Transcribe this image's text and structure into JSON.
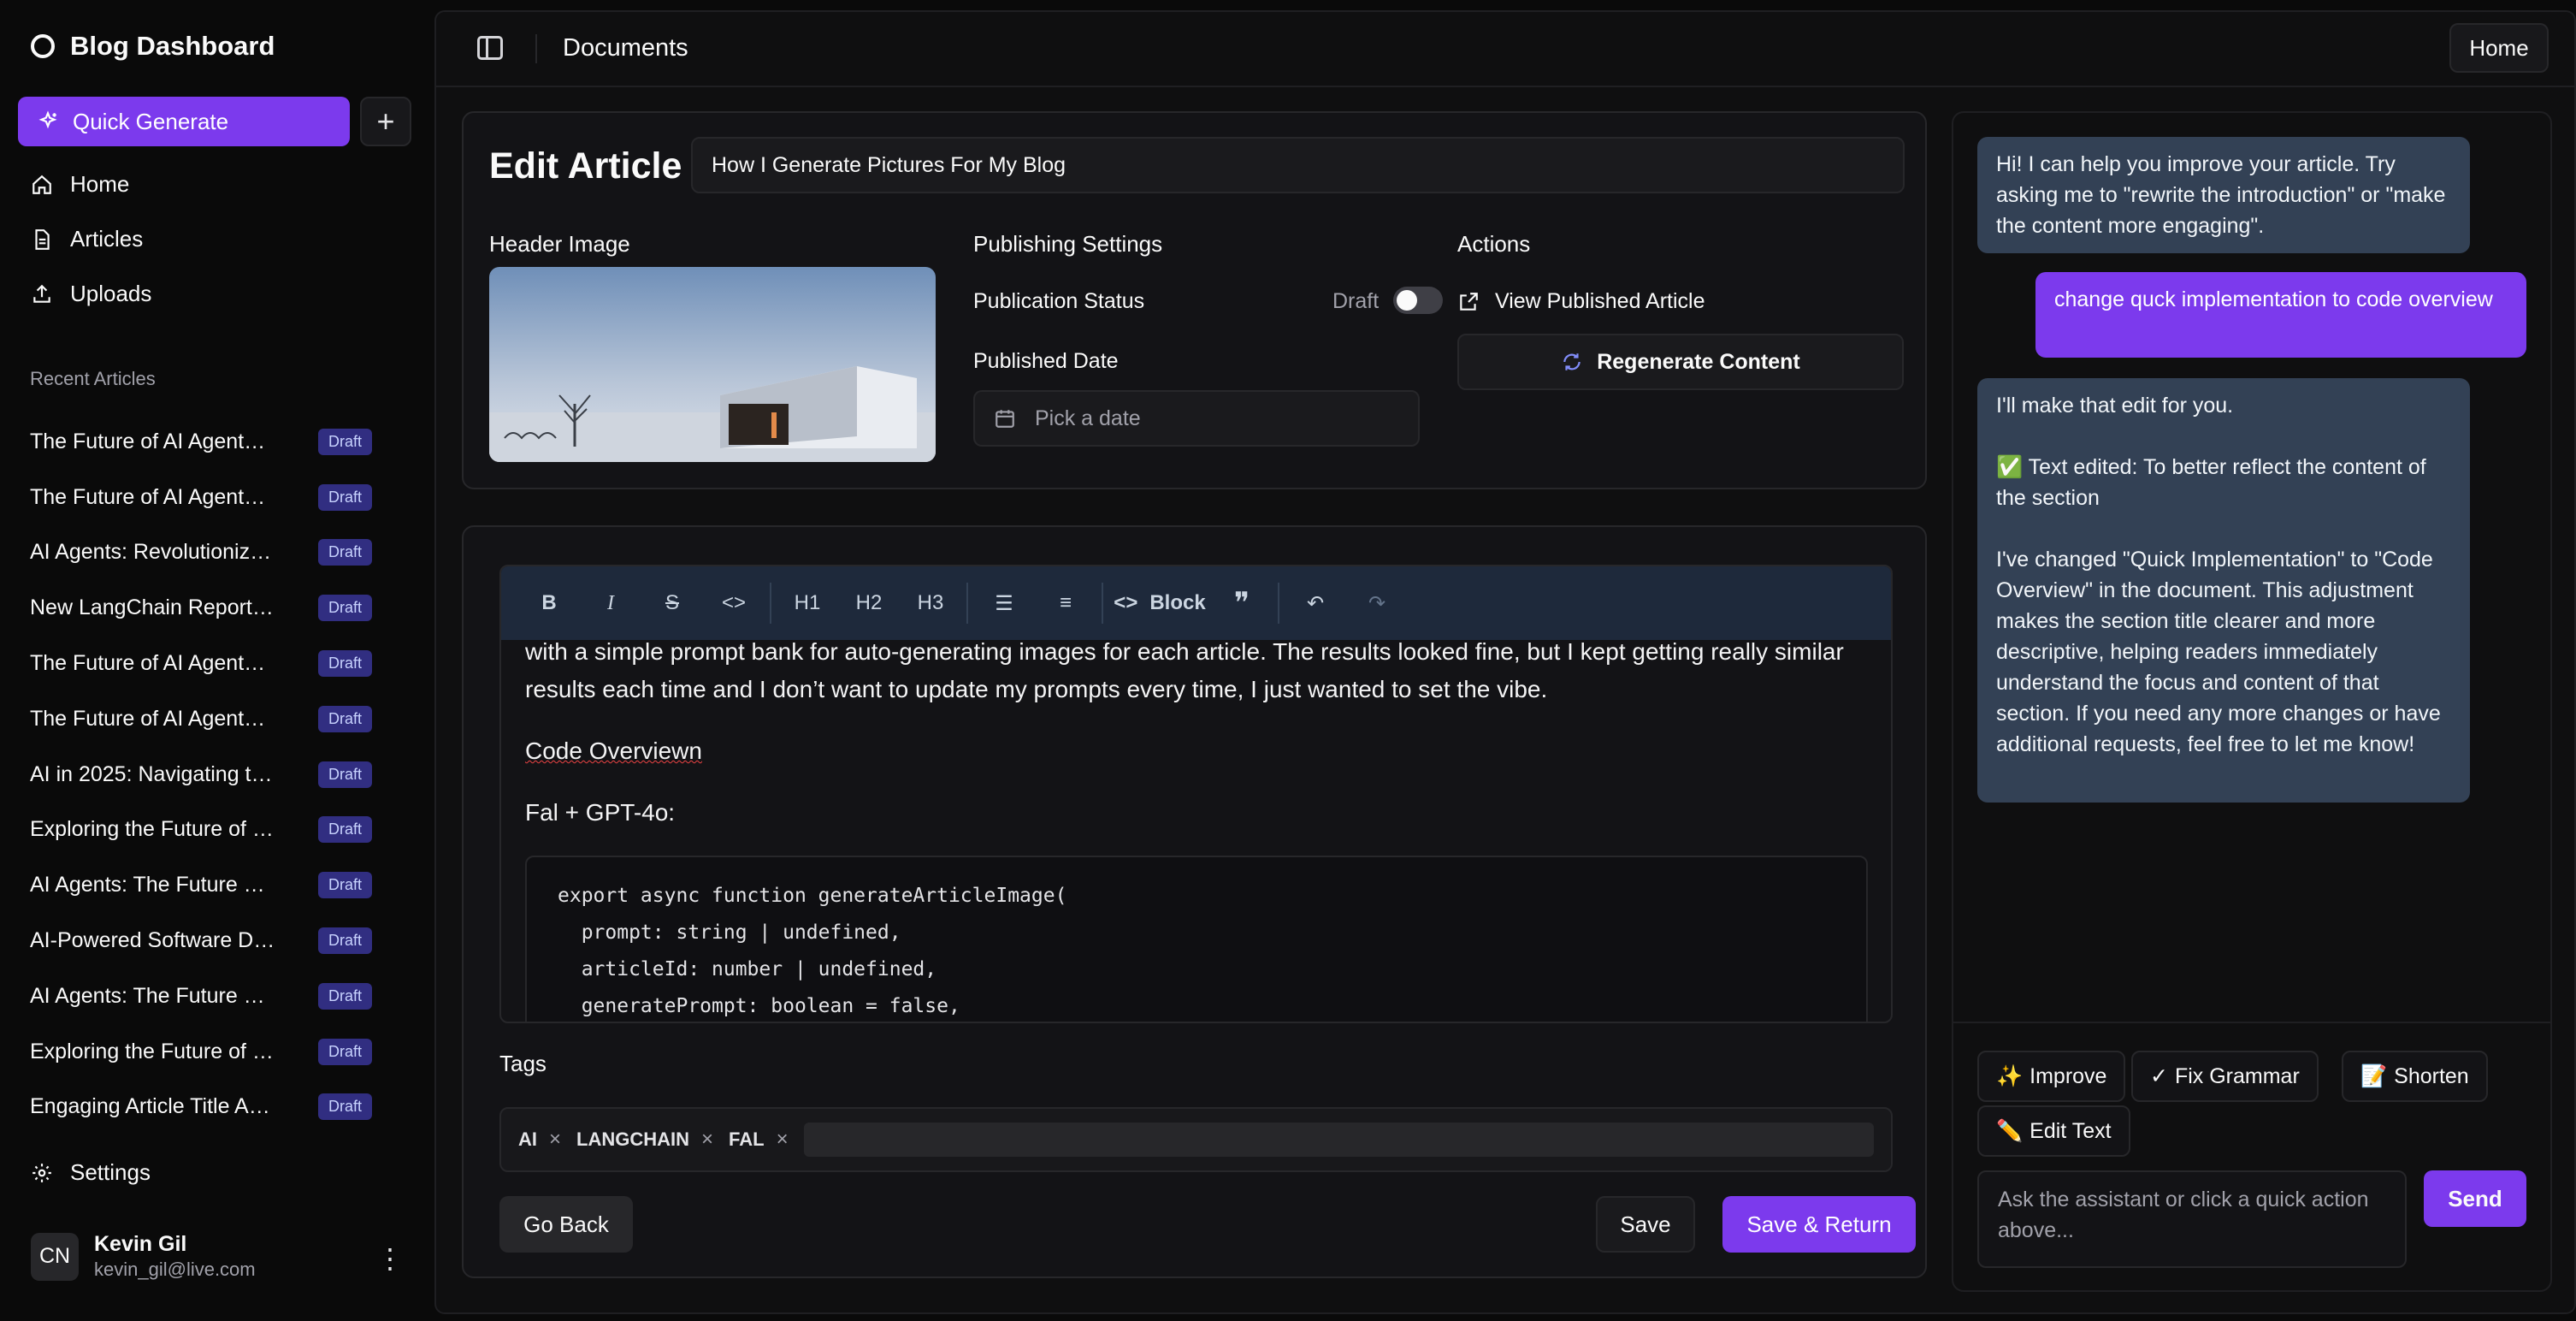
{
  "sidebar": {
    "brand": "Blog Dashboard",
    "quick_generate": "Quick Generate",
    "add_label": "+",
    "nav": [
      {
        "label": "Home",
        "icon": "home-icon"
      },
      {
        "label": "Articles",
        "icon": "file-icon"
      },
      {
        "label": "Uploads",
        "icon": "upload-icon"
      }
    ],
    "recent_label": "Recent Articles",
    "recent": [
      {
        "title": "The Future of AI Agent…",
        "badge": "Draft"
      },
      {
        "title": "The Future of AI Agent…",
        "badge": "Draft"
      },
      {
        "title": "AI Agents: Revolutioniz…",
        "badge": "Draft"
      },
      {
        "title": "New LangChain Report…",
        "badge": "Draft"
      },
      {
        "title": "The Future of AI Agent…",
        "badge": "Draft"
      },
      {
        "title": "The Future of AI Agent…",
        "badge": "Draft"
      },
      {
        "title": "AI in 2025: Navigating t…",
        "badge": "Draft"
      },
      {
        "title": "Exploring the Future of …",
        "badge": "Draft"
      },
      {
        "title": "AI Agents: The Future …",
        "badge": "Draft"
      },
      {
        "title": "AI-Powered Software D…",
        "badge": "Draft"
      },
      {
        "title": "AI Agents: The Future …",
        "badge": "Draft"
      },
      {
        "title": "Exploring the Future of …",
        "badge": "Draft"
      },
      {
        "title": "Engaging Article Title A…",
        "badge": "Draft"
      }
    ],
    "settings": "Settings",
    "user": {
      "initials": "CN",
      "name": "Kevin Gil",
      "email": "kevin_gil@live.com"
    }
  },
  "topbar": {
    "title": "Documents",
    "home": "Home"
  },
  "article": {
    "heading": "Edit Article",
    "title_value": "How I Generate Pictures For My Blog",
    "header_image_label": "Header Image",
    "publishing_label": "Publishing Settings",
    "status_label": "Publication Status",
    "status_value": "Draft",
    "date_label": "Published Date",
    "date_placeholder": "Pick a date",
    "actions_label": "Actions",
    "view_published": "View Published Article",
    "regenerate": "Regenerate Content"
  },
  "editor": {
    "toolbar": {
      "h1": "H1",
      "h2": "H2",
      "h3": "H3",
      "block": "Block"
    },
    "para1": "with a simple prompt bank for auto-generating images for each article. The results looked fine, but I kept getting really similar results each time and I don’t want to update my prompts every time, I just wanted to set the vibe.",
    "heading_text": "Code Overviewn",
    "subheading": "Fal + GPT-4o:",
    "code": "export async function generateArticleImage(\n  prompt: string | undefined,\n  articleId: number | undefined,\n  generatePrompt: boolean = false,"
  },
  "tags": {
    "label": "Tags",
    "items": [
      "AI",
      "LANGCHAIN",
      "FAL"
    ],
    "remove": "×"
  },
  "buttons": {
    "go_back": "Go Back",
    "save": "Save",
    "save_return": "Save & Return"
  },
  "chat": {
    "messages": [
      {
        "role": "assistant",
        "text": "Hi! I can help you improve your article. Try asking me to \"rewrite the introduction\" or \"make the content more engaging\"."
      },
      {
        "role": "user",
        "text": "change quck implementation to code overview"
      },
      {
        "role": "assistant",
        "p1": "I'll make that edit for you.",
        "p2": "✅ Text edited: To better reflect the content of the section",
        "p3": "I've changed \"Quick Implementation\" to \"Code Overview\" in the document. This adjustment makes the section title clearer and more descriptive, helping readers immediately understand the focus and content of that section. If you need any more changes or have additional requests, feel free to let me know!"
      }
    ],
    "quick_actions": [
      {
        "emoji": "✨",
        "label": "Improve"
      },
      {
        "emoji": "✓",
        "label": "Fix Grammar"
      },
      {
        "emoji": "📝",
        "label": "Shorten"
      },
      {
        "emoji": "✏️",
        "label": "Edit Text"
      }
    ],
    "input_placeholder": "Ask the assistant or click a quick action above...",
    "send": "Send"
  },
  "colors": {
    "accent": "#7c3aed",
    "badge_bg": "#312e81",
    "assistant_bubble": "#334155",
    "toolbar_bg": "#1e293b"
  }
}
